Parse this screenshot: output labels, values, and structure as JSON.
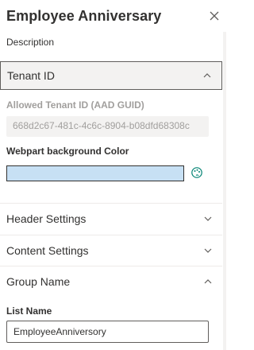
{
  "panel": {
    "title": "Employee Anniversary",
    "description": "Description"
  },
  "sections": {
    "tenant": {
      "label": "Tenant ID",
      "state": "expanded"
    },
    "header_settings": {
      "label": "Header Settings",
      "state": "collapsed"
    },
    "content_settings": {
      "label": "Content Settings",
      "state": "collapsed"
    },
    "group_name": {
      "label": "Group Name",
      "state": "expanded"
    }
  },
  "fields": {
    "allowed_tenant_label": "Allowed Tenant ID (AAD GUID)",
    "allowed_tenant_value": "668d2c67-481c-4c6c-8904-b08dfd68308c",
    "bg_color_label": "Webpart background Color",
    "bg_color_value": "#c7e0f4",
    "list_name_label": "List Name",
    "list_name_value": "EmployeeAnniversory"
  },
  "icons": {
    "close": "close-icon",
    "chevron_up": "chevron-up-icon",
    "chevron_down": "chevron-down-icon",
    "palette": "color-palette-icon"
  },
  "colors": {
    "accent": "#0078d4",
    "swatch": "#c7e0f4",
    "text": "#323130",
    "muted": "#a19f9d"
  }
}
